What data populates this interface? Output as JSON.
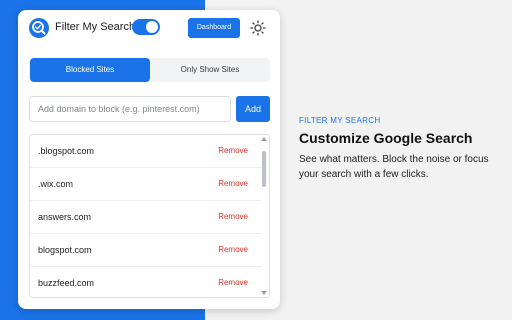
{
  "colors": {
    "accent": "#1a73e8",
    "remove": "#d93025",
    "background": "#f2f2f2",
    "panel": "#ffffff"
  },
  "header": {
    "logo_icon": "magnifier-check-icon",
    "title": "Filter My Search",
    "toggle_on": true,
    "dashboard_label": "Dashboard",
    "theme_icon": "sun-icon"
  },
  "tabs": [
    {
      "label": "Blocked Sites",
      "active": true
    },
    {
      "label": "Only Show Sites",
      "active": false
    }
  ],
  "add_form": {
    "placeholder": "Add domain to block (e.g. pinterest.com)",
    "value": "",
    "add_label": "Add"
  },
  "blocked_list": {
    "items": [
      {
        "domain": ".blogspot.com",
        "action": "Remove"
      },
      {
        "domain": ".wix.com",
        "action": "Remove"
      },
      {
        "domain": "answers.com",
        "action": "Remove"
      },
      {
        "domain": "blogspot.com",
        "action": "Remove"
      },
      {
        "domain": "buzzfeed.com",
        "action": "Remove"
      }
    ]
  },
  "promo": {
    "eyebrow": "FILTER MY SEARCH",
    "headline": "Customize Google Search",
    "body": "See what matters. Block the noise or focus your search with a few clicks."
  }
}
